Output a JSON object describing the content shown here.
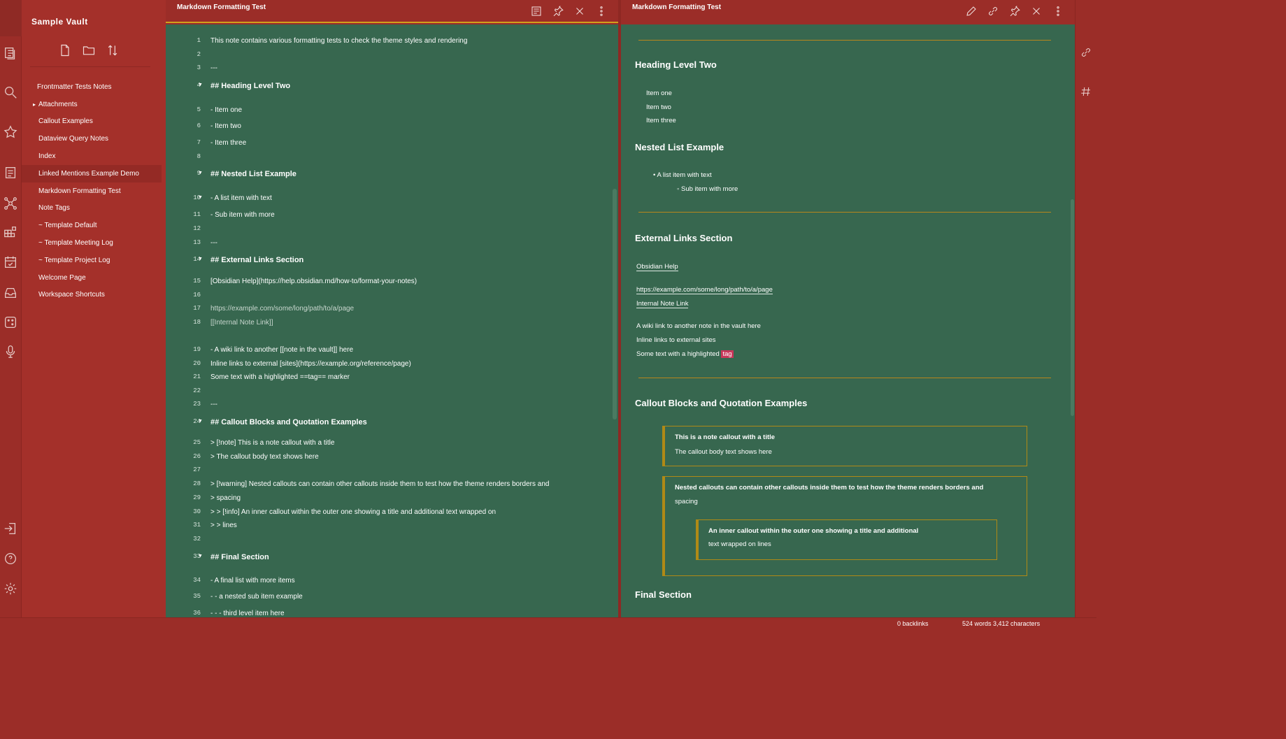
{
  "app": {
    "vault_name": "Sample Vault"
  },
  "ribbon": {
    "icons": [
      "files-icon",
      "search-icon",
      "star-icon",
      "note-icon",
      "graph-icon",
      "grid-icon",
      "calendar-icon",
      "archive-icon",
      "dice-icon",
      "microphone-icon"
    ],
    "bottom_icons": [
      "exit-vault-icon",
      "help-icon",
      "settings-icon"
    ]
  },
  "sidebar": {
    "actions": [
      "new-note-icon",
      "new-folder-icon",
      "sort-icon"
    ],
    "tree": [
      {
        "label": "Frontmatter Tests Notes",
        "indent": 0,
        "caret": ""
      },
      {
        "label": "Attachments",
        "indent": 1,
        "caret": "▸"
      },
      {
        "label": "Callout Examples",
        "indent": 1,
        "caret": ""
      },
      {
        "label": "Dataview Query Notes",
        "indent": 1,
        "caret": ""
      },
      {
        "label": "Index",
        "indent": 1,
        "caret": ""
      },
      {
        "label": "Linked Mentions Example Demo",
        "indent": 1,
        "caret": ""
      },
      {
        "label": "Markdown Formatting Test",
        "indent": 1,
        "caret": ""
      },
      {
        "label": "Note Tags",
        "indent": 1,
        "caret": ""
      },
      {
        "label": "~ Template Default",
        "indent": 1,
        "caret": ""
      },
      {
        "label": "~ Template Meeting Log",
        "indent": 1,
        "caret": ""
      },
      {
        "label": "~ Template Project Log",
        "indent": 1,
        "caret": ""
      },
      {
        "label": "Welcome Page",
        "indent": 1,
        "caret": ""
      },
      {
        "label": "Workspace Shortcuts",
        "indent": 1,
        "caret": ""
      }
    ]
  },
  "editor": {
    "title": "Markdown Formatting Test",
    "actions": [
      "reading-view-icon",
      "pin-icon",
      "close-icon",
      "more-options-icon"
    ],
    "lines": [
      {
        "n": "1",
        "text": "This note contains various formatting tests to check the theme styles and rendering",
        "cls": "",
        "fold": false
      },
      {
        "n": "2",
        "text": "",
        "cls": "",
        "fold": false
      },
      {
        "n": "3",
        "text": "---",
        "cls": "",
        "fold": false
      },
      {
        "n": "4",
        "text": "## Heading Level Two",
        "cls": "h",
        "fold": true
      },
      {
        "n": "5",
        "text": "- Item one",
        "cls": "",
        "fold": false
      },
      {
        "n": "6",
        "text": "- Item two",
        "cls": "",
        "fold": false
      },
      {
        "n": "7",
        "text": "- Item three",
        "cls": "",
        "fold": false
      },
      {
        "n": "8",
        "text": "",
        "cls": "",
        "fold": false
      },
      {
        "n": "9",
        "text": "## Nested List Example",
        "cls": "h",
        "fold": true
      },
      {
        "n": "10",
        "text": "- A list item with text",
        "cls": "",
        "fold": true
      },
      {
        "n": "11",
        "text": "- Sub item with more",
        "cls": "",
        "fold": false
      },
      {
        "n": "12",
        "text": "",
        "cls": "",
        "fold": false
      },
      {
        "n": "13",
        "text": "---",
        "cls": "",
        "fold": false
      },
      {
        "n": "14",
        "text": "## External Links Section",
        "cls": "h",
        "fold": true
      },
      {
        "n": "15",
        "text": "[Obsidian Help](https://help.obsidian.md/how-to/format-your-notes)",
        "cls": "",
        "fold": false
      },
      {
        "n": "16",
        "text": "",
        "cls": "",
        "fold": false
      },
      {
        "n": "17",
        "text": "https://example.com/some/long/path/to/a/page",
        "cls": "dim",
        "fold": false
      },
      {
        "n": "18",
        "text": "[[Internal Note Link]]",
        "cls": "dim",
        "fold": false
      },
      {
        "n": "19",
        "text": "- A wiki link to another [[note in the vault]] here",
        "cls": "",
        "fold": false
      },
      {
        "n": "20",
        "text": "Inline links to external [sites](https://example.org/reference/page)",
        "cls": "",
        "fold": false
      },
      {
        "n": "21",
        "text": "Some text with a highlighted ==tag== marker",
        "cls": "",
        "fold": false
      },
      {
        "n": "22",
        "text": "",
        "cls": "",
        "fold": false
      },
      {
        "n": "23",
        "text": "---",
        "cls": "",
        "fold": false
      },
      {
        "n": "24",
        "text": "## Callout Blocks and Quotation Examples",
        "cls": "h",
        "fold": true
      },
      {
        "n": "25",
        "text": "> [!note] This is a note callout with a title",
        "cls": "",
        "fold": false
      },
      {
        "n": "26",
        "text": "> The callout body text shows here",
        "cls": "",
        "fold": false
      },
      {
        "n": "27",
        "text": "",
        "cls": "",
        "fold": false
      },
      {
        "n": "28",
        "text": "> [!warning] Nested callouts can contain other callouts inside them to test how the theme renders borders and",
        "cls": "",
        "fold": false
      },
      {
        "n": "29",
        "text": "> spacing",
        "cls": "",
        "fold": false
      },
      {
        "n": "30",
        "text": "> > [!info] An inner callout within the outer one showing a title and additional text wrapped on",
        "cls": "",
        "fold": false
      },
      {
        "n": "31",
        "text": "> > lines",
        "cls": "",
        "fold": false
      },
      {
        "n": "32",
        "text": "",
        "cls": "",
        "fold": false
      },
      {
        "n": "33",
        "text": "## Final Section",
        "cls": "h",
        "fold": true
      },
      {
        "n": "34",
        "text": "- A final list with more items",
        "cls": "",
        "fold": false
      },
      {
        "n": "35",
        "text": "- - a nested sub item example",
        "cls": "",
        "fold": false
      },
      {
        "n": "36",
        "text": "- - - third level item here",
        "cls": "",
        "fold": false
      }
    ]
  },
  "preview": {
    "title": "Markdown Formatting Test",
    "actions": [
      "edit-icon",
      "link-icon",
      "pin-icon",
      "close-icon",
      "more-options-icon"
    ],
    "h1": "Heading Level Two",
    "list1": [
      "Item one",
      "Item two",
      "Item three"
    ],
    "h2": "Nested List Example",
    "nested_item": "A list item with text",
    "nested_sub": "Sub item with more",
    "h3": "External Links Section",
    "link1": "Obsidian Help",
    "link2": "https://example.com/some/long/path/to/a/page",
    "link2b": "Internal Note Link",
    "line_a": "A wiki link to another note in the vault here",
    "line_b": "Inline links to external sites",
    "line_c": "Some text with a highlighted",
    "line_c_hl": "tag",
    "h4": "Callout Blocks and Quotation Examples",
    "callout1_title": "This is a note callout with a title",
    "callout1_body": "The callout body text shows here",
    "callout2_title": "Nested callouts can contain other callouts inside them to test how the theme renders borders and",
    "callout2_body": "spacing",
    "callout3_title": "An inner callout within the outer one showing a title and additional",
    "callout3_body": "text wrapped on lines",
    "h5": "Final Section"
  },
  "right_ribbon": {
    "icons": [
      "backlinks-icon",
      "tags-icon"
    ]
  },
  "status": {
    "backlinks": "0 backlinks",
    "stats": "524 words 3,412 characters"
  },
  "colors": {
    "accent": "#d1a11c",
    "frame": "#9b2d28",
    "editor_bg": "#37674f",
    "highlight": "#c9375a"
  }
}
